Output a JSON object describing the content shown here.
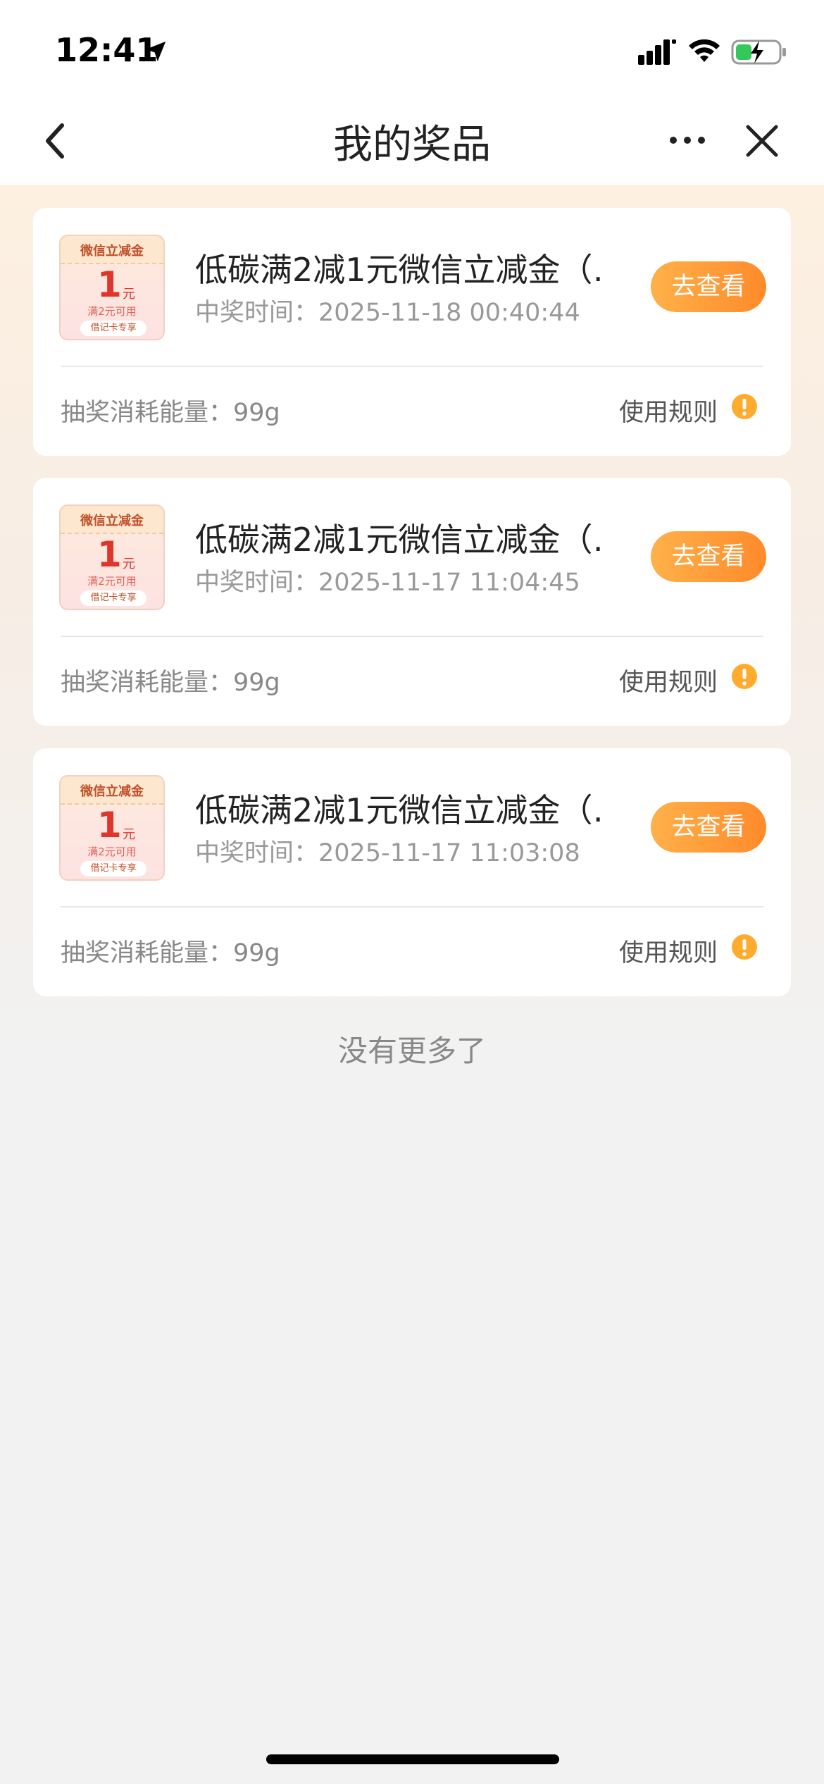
{
  "status_bar": {
    "time": "12:41",
    "icons": [
      "location-arrow-icon",
      "cellular-signal-icon",
      "wifi-icon",
      "battery-charging-icon"
    ]
  },
  "nav": {
    "title": "我的奖品",
    "icons": [
      "back-chevron-icon",
      "more-dots-icon",
      "close-icon"
    ]
  },
  "coupon_art": {
    "title": "微信立减金",
    "amount": "1",
    "unit": "元",
    "condition": "满2元可用",
    "tag": "借记卡专享"
  },
  "prizes": [
    {
      "name": "低碳满2减1元微信立减金（…",
      "win_time": "中奖时间：2025-11-18 00:40:44",
      "view_label": "去查看",
      "energy": "抽奖消耗能量：99g",
      "rules_label": "使用规则"
    },
    {
      "name": "低碳满2减1元微信立减金（…",
      "win_time": "中奖时间：2025-11-17 11:04:45",
      "view_label": "去查看",
      "energy": "抽奖消耗能量：99g",
      "rules_label": "使用规则"
    },
    {
      "name": "低碳满2减1元微信立减金（…",
      "win_time": "中奖时间：2025-11-17 11:03:08",
      "view_label": "去查看",
      "energy": "抽奖消耗能量：99g",
      "rules_label": "使用规则"
    }
  ],
  "footer": {
    "no_more": "没有更多了"
  },
  "colors": {
    "accent_orange": "#ff9a35",
    "coupon_red": "#e0352b",
    "page_bg": "#f2f2f2"
  }
}
